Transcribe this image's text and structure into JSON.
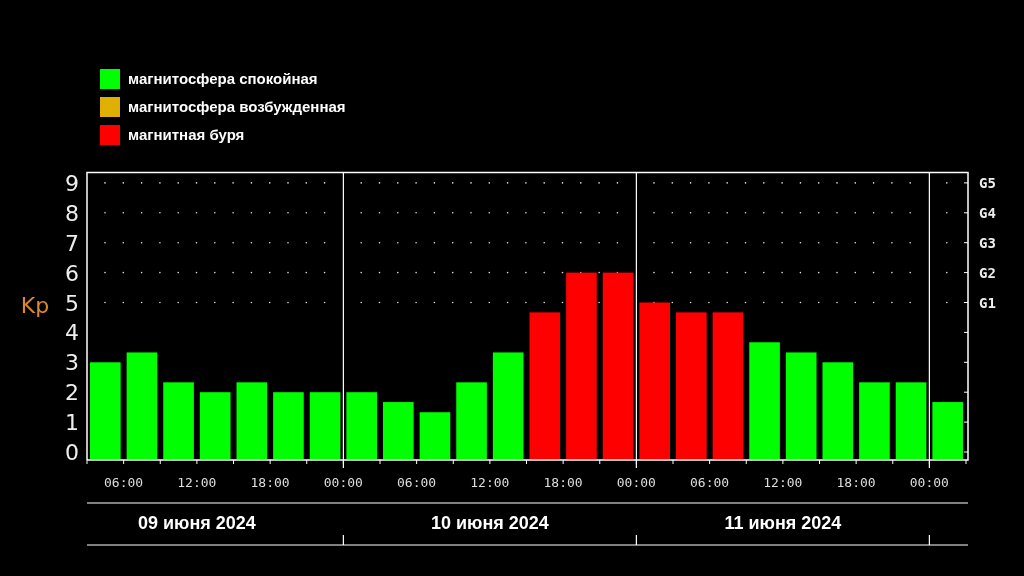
{
  "chart_data": {
    "type": "bar",
    "stacked": true,
    "ylabel": "Kp",
    "grid": true,
    "series": [
      {
        "name": "магнитосфера спокойная",
        "color": "#00ff00",
        "values": [
          3,
          3.33,
          2.33,
          2,
          2.33,
          2,
          2,
          2,
          1.67,
          1.33,
          2.33,
          3.33,
          null,
          null,
          null,
          null,
          null,
          null,
          3.67,
          3.33,
          3,
          2.33,
          2.33,
          1.67
        ]
      },
      {
        "name": "магнитосфера возбужденная",
        "color": "#e0b000",
        "values": [
          null,
          null,
          null,
          null,
          null,
          null,
          null,
          null,
          null,
          null,
          null,
          null,
          null,
          null,
          null,
          null,
          null,
          null,
          null,
          null,
          null,
          null,
          null,
          null
        ]
      },
      {
        "name": "магнитная буря",
        "color": "#ff0000",
        "values": [
          null,
          null,
          null,
          null,
          null,
          null,
          null,
          null,
          null,
          null,
          null,
          null,
          4.67,
          6,
          6,
          5,
          4.67,
          4.67,
          null,
          null,
          null,
          null,
          null,
          null
        ]
      }
    ],
    "ylim": [
      0,
      9.35
    ],
    "yticks": [
      0,
      1,
      2,
      3,
      4,
      5,
      6,
      7,
      8,
      9
    ]
  },
  "time_labels": [
    "06:00",
    "12:00",
    "18:00",
    "00:00",
    "06:00",
    "12:00",
    "18:00",
    "00:00",
    "06:00",
    "12:00",
    "18:00",
    "00:00"
  ],
  "storm_scale": [
    "G5",
    "G4",
    "G3",
    "G2",
    "G1"
  ],
  "dates": [
    "09 июня 2024",
    "10 июня 2024",
    "11 июня 2024"
  ]
}
